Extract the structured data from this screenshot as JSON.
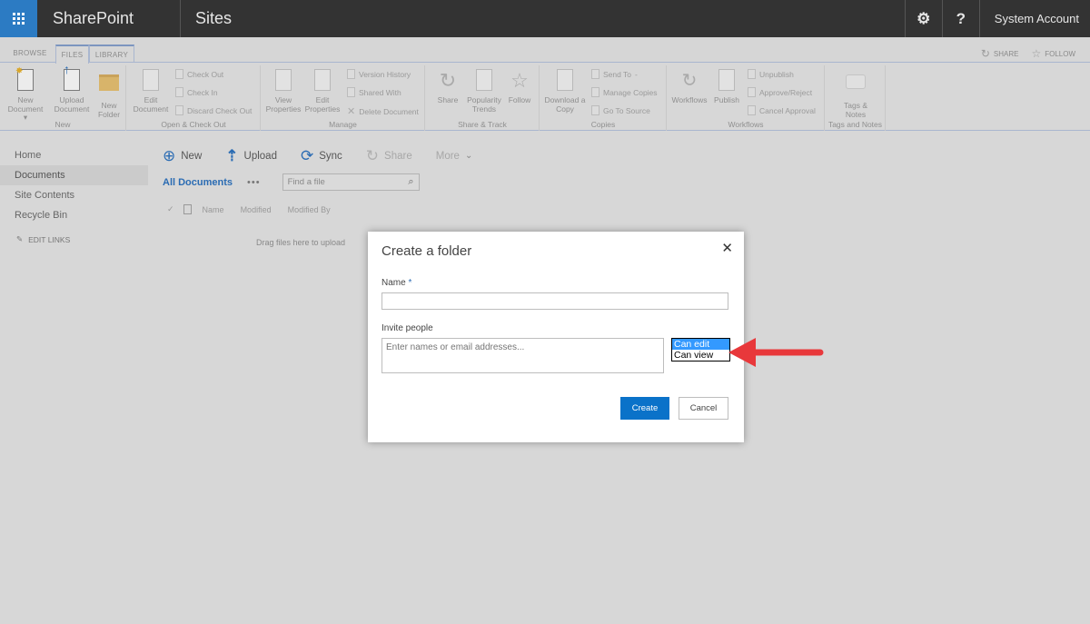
{
  "suitebar": {
    "app_name": "SharePoint",
    "section": "Sites",
    "settings_icon": "gear-icon",
    "help_label": "?",
    "account": "System Account"
  },
  "ribbon_tabs": {
    "tabs": [
      {
        "label": "BROWSE",
        "active": false
      },
      {
        "label": "FILES",
        "active": true
      },
      {
        "label": "LIBRARY",
        "active": false
      }
    ],
    "share_label": "SHARE",
    "follow_label": "FOLLOW"
  },
  "ribbon": {
    "groups": [
      {
        "label": "New",
        "buttons": [
          "New Document",
          "Upload Document",
          "New Folder"
        ]
      },
      {
        "label": "Open & Check Out",
        "buttons": [
          "Edit Document"
        ],
        "small": [
          "Check Out",
          "Check In",
          "Discard Check Out"
        ]
      },
      {
        "label": "Manage",
        "buttons": [
          "View Properties",
          "Edit Properties"
        ],
        "small": [
          "Version History",
          "Shared With",
          "Delete Document"
        ]
      },
      {
        "label": "Share & Track",
        "buttons": [
          "Share",
          "Popularity Trends",
          "Follow"
        ]
      },
      {
        "label": "Copies",
        "buttons": [
          "Download a Copy"
        ],
        "small": [
          "Send To",
          "Manage Copies",
          "Go To Source"
        ]
      },
      {
        "label": "Workflows",
        "buttons": [
          "Workflows",
          "Publish"
        ],
        "small": [
          "Unpublish",
          "Approve/Reject",
          "Cancel Approval"
        ]
      },
      {
        "label": "Tags and Notes",
        "buttons": [
          "Tags & Notes"
        ]
      }
    ],
    "new_doc_line1": "New",
    "new_doc_line2": "Document",
    "upload_line1": "Upload",
    "upload_line2": "Document",
    "folder_line1": "New",
    "folder_line2": "Folder",
    "edit_doc_line1": "Edit",
    "edit_doc_line2": "Document",
    "view_props_line1": "View",
    "view_props_line2": "Properties",
    "edit_props_line1": "Edit",
    "edit_props_line2": "Properties",
    "share": "Share",
    "pop_line1": "Popularity",
    "pop_line2": "Trends",
    "follow": "Follow",
    "download_line1": "Download a",
    "download_line2": "Copy",
    "workflows": "Workflows",
    "publish": "Publish",
    "tags_line1": "Tags &",
    "tags_line2": "Notes"
  },
  "leftnav": {
    "items": [
      {
        "label": "Home",
        "selected": false
      },
      {
        "label": "Documents",
        "selected": true
      },
      {
        "label": "Site Contents",
        "selected": false
      },
      {
        "label": "Recycle Bin",
        "selected": false
      }
    ],
    "edit_links": "EDIT LINKS"
  },
  "commands": {
    "new": "New",
    "upload": "Upload",
    "sync": "Sync",
    "share": "Share",
    "more": "More"
  },
  "view": {
    "current": "All Documents",
    "ellipsis": "•••",
    "search_placeholder": "Find a file"
  },
  "columns": [
    "Name",
    "Modified",
    "Modified By"
  ],
  "empty_text": "Drag files here to upload",
  "dialog": {
    "title": "Create a folder",
    "name_label": "Name",
    "required_mark": "*",
    "name_value": "",
    "invite_label": "Invite people",
    "invite_placeholder": "Enter names or email addresses...",
    "permission_options": [
      "Can edit",
      "Can view"
    ],
    "permission_selected": "Can edit",
    "create_label": "Create",
    "cancel_label": "Cancel"
  },
  "annotation": {
    "arrow_color": "#e8383b"
  }
}
